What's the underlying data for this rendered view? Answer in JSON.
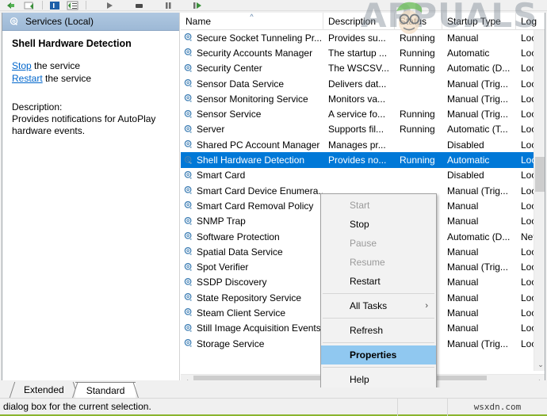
{
  "window": {
    "title": "Services (Local)",
    "accent_selection": "#0078d7",
    "menu_highlight": "#90c8f0"
  },
  "toolbar": {
    "buttons": [
      {
        "name": "back-icon",
        "label": "Back"
      },
      {
        "name": "forward-icon",
        "label": "Forward"
      },
      {
        "name": "show-hide-console-tree-icon",
        "label": "Show/Hide Console Tree"
      },
      {
        "name": "properties-icon",
        "label": "Properties"
      },
      {
        "name": "start-service-icon",
        "label": "Start Service"
      },
      {
        "name": "stop-service-icon",
        "label": "Stop Service"
      },
      {
        "name": "pause-service-icon",
        "label": "Pause Service"
      },
      {
        "name": "restart-service-icon",
        "label": "Restart Service"
      }
    ]
  },
  "left_pane": {
    "header_title": "Services (Local)",
    "header_icon": "gear-icon",
    "service_title": "Shell Hardware Detection",
    "links": [
      {
        "link_text": "Stop",
        "suffix": " the service"
      },
      {
        "link_text": "Restart",
        "suffix": " the service"
      }
    ],
    "description_label": "Description:",
    "description_text": "Provides notifications for AutoPlay hardware events."
  },
  "list": {
    "columns": [
      {
        "key": "name",
        "label": "Name",
        "sorted": true,
        "sort_dir": "asc"
      },
      {
        "key": "desc",
        "label": "Description",
        "sorted": false
      },
      {
        "key": "stat",
        "label": "Status",
        "sorted": false
      },
      {
        "key": "start",
        "label": "Startup Type",
        "sorted": false
      },
      {
        "key": "log",
        "label": "Log",
        "sorted": false
      }
    ],
    "rows": [
      {
        "name": "Secure Socket Tunneling Pr...",
        "desc": "Provides su...",
        "stat": "Running",
        "start": "Manual",
        "log": "Loc",
        "selected": false
      },
      {
        "name": "Security Accounts Manager",
        "desc": "The startup ...",
        "stat": "Running",
        "start": "Automatic",
        "log": "Loc",
        "selected": false
      },
      {
        "name": "Security Center",
        "desc": "The WSCSV...",
        "stat": "Running",
        "start": "Automatic (D...",
        "log": "Loc",
        "selected": false
      },
      {
        "name": "Sensor Data Service",
        "desc": "Delivers dat...",
        "stat": "",
        "start": "Manual (Trig...",
        "log": "Loc",
        "selected": false
      },
      {
        "name": "Sensor Monitoring Service",
        "desc": "Monitors va...",
        "stat": "",
        "start": "Manual (Trig...",
        "log": "Loc",
        "selected": false
      },
      {
        "name": "Sensor Service",
        "desc": "A service fo...",
        "stat": "Running",
        "start": "Manual (Trig...",
        "log": "Loc",
        "selected": false
      },
      {
        "name": "Server",
        "desc": "Supports fil...",
        "stat": "Running",
        "start": "Automatic (T...",
        "log": "Loc",
        "selected": false
      },
      {
        "name": "Shared PC Account Manager",
        "desc": "Manages pr...",
        "stat": "",
        "start": "Disabled",
        "log": "Loc",
        "selected": false
      },
      {
        "name": "Shell Hardware Detection",
        "desc": "Provides no...",
        "stat": "Running",
        "start": "Automatic",
        "log": "Loc",
        "selected": true
      },
      {
        "name": "Smart Card",
        "desc": "",
        "stat": "",
        "start": "Disabled",
        "log": "Loc",
        "selected": false
      },
      {
        "name": "Smart Card Device Enumera...",
        "desc": "",
        "stat": "",
        "start": "Manual (Trig...",
        "log": "Loc",
        "selected": false
      },
      {
        "name": "Smart Card Removal Policy",
        "desc": "",
        "stat": "",
        "start": "Manual",
        "log": "Loc",
        "selected": false
      },
      {
        "name": "SNMP Trap",
        "desc": "",
        "stat": "",
        "start": "Manual",
        "log": "Loc",
        "selected": false
      },
      {
        "name": "Software Protection",
        "desc": "",
        "stat": "",
        "start": "Automatic (D...",
        "log": "Net",
        "selected": false
      },
      {
        "name": "Spatial Data Service",
        "desc": "",
        "stat": "",
        "start": "Manual",
        "log": "Loc",
        "selected": false
      },
      {
        "name": "Spot Verifier",
        "desc": "",
        "stat": "",
        "start": "Manual (Trig...",
        "log": "Loc",
        "selected": false
      },
      {
        "name": "SSDP Discovery",
        "desc": "",
        "stat": "",
        "start": "Manual",
        "log": "Loc",
        "selected": false
      },
      {
        "name": "State Repository Service",
        "desc": "",
        "stat": "",
        "start": "Manual",
        "log": "Loc",
        "selected": false
      },
      {
        "name": "Steam Client Service",
        "desc": "",
        "stat": "",
        "start": "Manual",
        "log": "Loc",
        "selected": false
      },
      {
        "name": "Still Image Acquisition Events",
        "desc": "",
        "stat": "",
        "start": "Manual",
        "log": "Loc",
        "selected": false
      },
      {
        "name": "Storage Service",
        "desc": "",
        "stat": "",
        "start": "Manual (Trig...",
        "log": "Loc",
        "selected": false
      }
    ]
  },
  "context_menu": {
    "items": [
      {
        "label": "Start",
        "state": "disabled",
        "separator_after": false
      },
      {
        "label": "Stop",
        "state": "normal",
        "separator_after": false
      },
      {
        "label": "Pause",
        "state": "disabled",
        "separator_after": false
      },
      {
        "label": "Resume",
        "state": "disabled",
        "separator_after": false
      },
      {
        "label": "Restart",
        "state": "normal",
        "separator_after": true
      },
      {
        "label": "All Tasks",
        "state": "submenu",
        "separator_after": true
      },
      {
        "label": "Refresh",
        "state": "normal",
        "separator_after": true
      },
      {
        "label": "Properties",
        "state": "highlighted",
        "separator_after": true
      },
      {
        "label": "Help",
        "state": "normal",
        "separator_after": false
      }
    ],
    "submenu_arrow": "›"
  },
  "tabs": [
    {
      "label": "Extended",
      "active": false
    },
    {
      "label": "Standard",
      "active": true
    }
  ],
  "status_bar": {
    "text": "dialog box for the current selection.",
    "watermark": "wsxdn.com"
  },
  "watermark": {
    "brand": "APPUALS"
  }
}
